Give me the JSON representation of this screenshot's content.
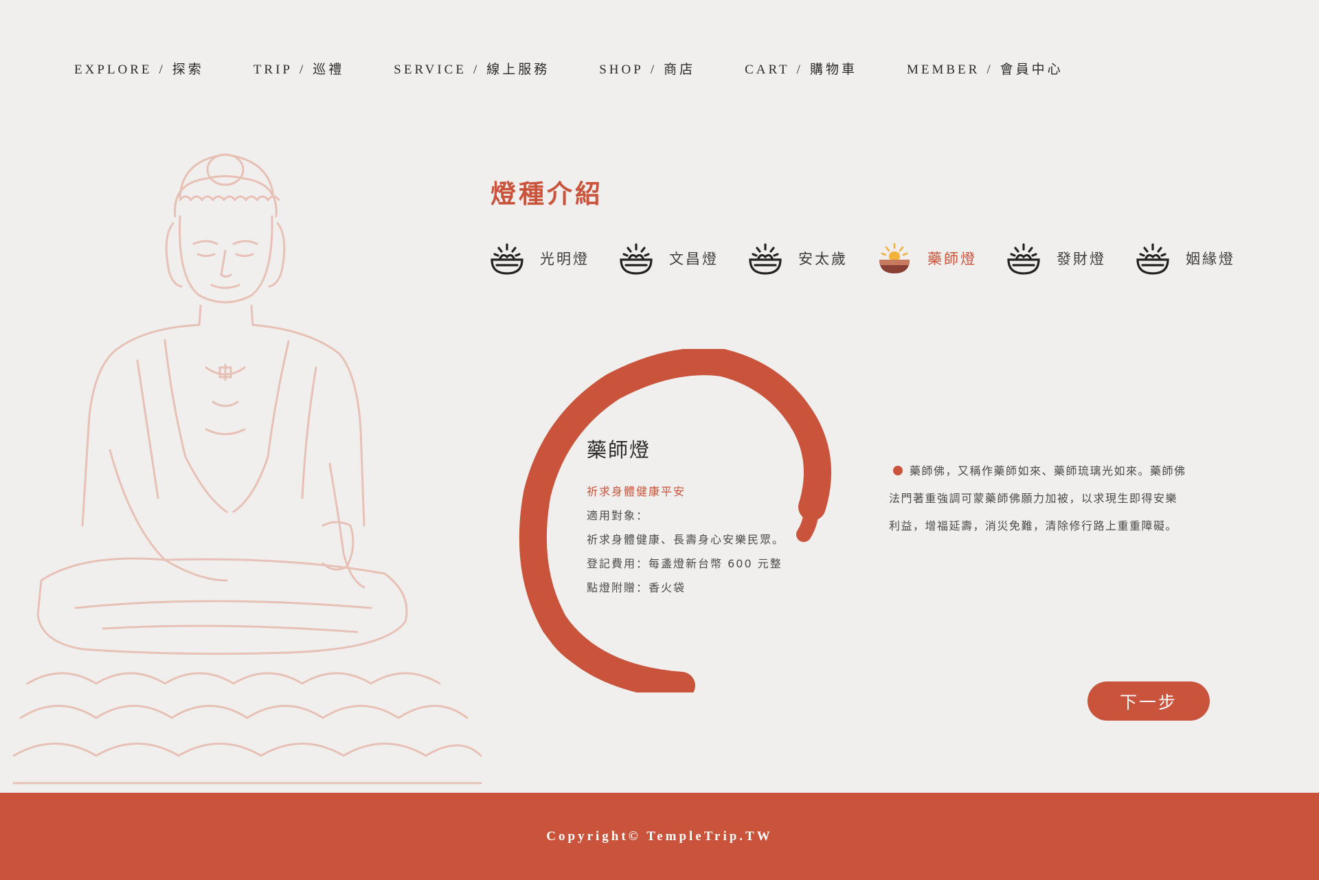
{
  "nav": {
    "items": [
      {
        "en": "EXPLORE",
        "zh": "探索"
      },
      {
        "en": "TRIP",
        "zh": "巡禮"
      },
      {
        "en": "SERVICE",
        "zh": "線上服務"
      },
      {
        "en": "SHOP",
        "zh": "商店"
      },
      {
        "en": "CART",
        "zh": "購物車"
      },
      {
        "en": "MEMBER",
        "zh": "會員中心"
      }
    ],
    "separator": "/"
  },
  "section": {
    "title": "燈種介紹"
  },
  "lamps": [
    {
      "label": "光明燈",
      "icon": "lamp-bowl-icon",
      "active": false
    },
    {
      "label": "文昌燈",
      "icon": "lamp-bowl-icon",
      "active": false
    },
    {
      "label": "安太歲",
      "icon": "lamp-bowl-icon",
      "active": false
    },
    {
      "label": "藥師燈",
      "icon": "lamp-bowl-icon",
      "active": true
    },
    {
      "label": "發財燈",
      "icon": "lamp-bowl-icon",
      "active": false
    },
    {
      "label": "姻緣燈",
      "icon": "lamp-bowl-icon",
      "active": false
    }
  ],
  "card": {
    "title": "藥師燈",
    "subtitle": "祈求身體健康平安",
    "target_label": "適用對象：",
    "target_value": "祈求身體健康、長壽身心安樂民眾。",
    "fee": "登記費用：每盞燈新台幣 600 元整",
    "gift": "點燈附贈：香火袋"
  },
  "description": {
    "lines": [
      "藥師佛，又稱作藥師如來、藥師琉璃光如來。藥師佛",
      "法門著重強調可蒙藥師佛願力加被，以求現生即得安樂",
      "利益，增福延壽，消災免難，清除修行路上重重障礙。"
    ]
  },
  "next_button": {
    "label": "下一步"
  },
  "footer": {
    "copyright": "Copyright© TempleTrip.TW"
  },
  "colors": {
    "accent": "#c9533b",
    "background": "#f0efee",
    "text": "#2a2a2a"
  }
}
